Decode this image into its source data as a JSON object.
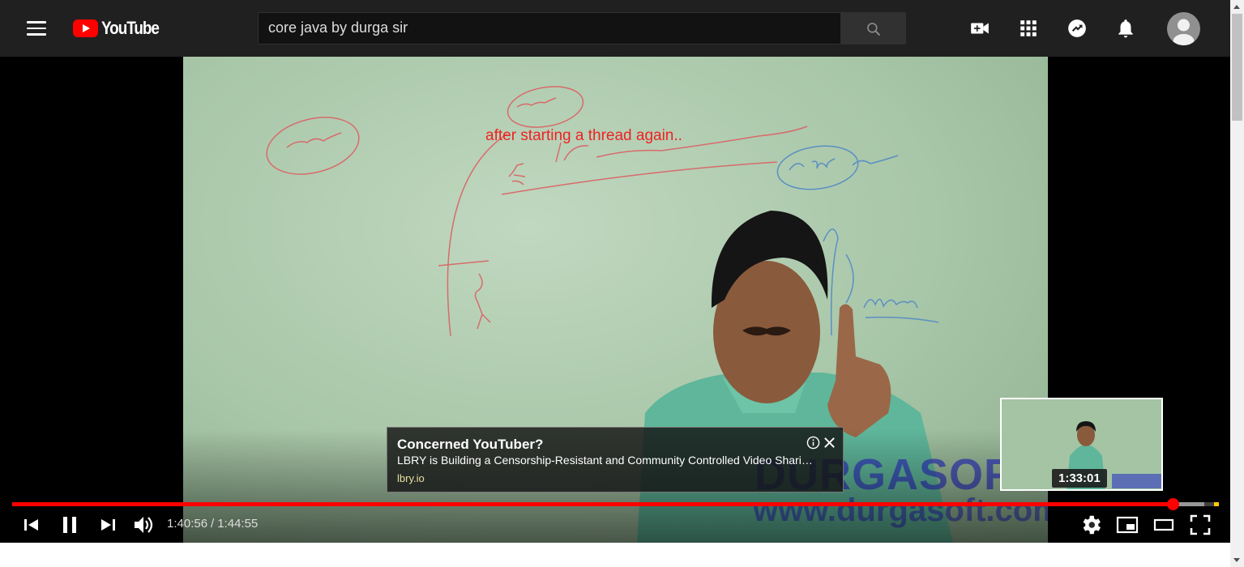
{
  "masthead": {
    "logo_text": "YouTube",
    "search_value": "core java by durga sir",
    "icons": [
      "menu-icon",
      "search-icon",
      "create-video-icon",
      "apps-icon",
      "messages-icon",
      "notifications-icon",
      "avatar"
    ]
  },
  "video": {
    "overlay_annotation": "after starting a thread again..",
    "ad": {
      "title": "Concerned YouTuber?",
      "description": "LBRY is Building a Censorship-Resistant and Community Controlled Video Shari…",
      "url": "lbry.io"
    },
    "preview_time": "1:33:01",
    "current_time": "1:40:56",
    "duration": "1:44:55",
    "time_separator": "/",
    "progress_fraction": 0.962,
    "buffered_fraction": 0.988,
    "colors": {
      "progress": "#ff0000",
      "ad_marker": "#ffcc00"
    }
  },
  "controls": [
    "previous-icon",
    "pause-icon",
    "next-icon",
    "volume-icon",
    "settings-icon",
    "miniplayer-icon",
    "theater-mode-icon",
    "fullscreen-icon"
  ]
}
